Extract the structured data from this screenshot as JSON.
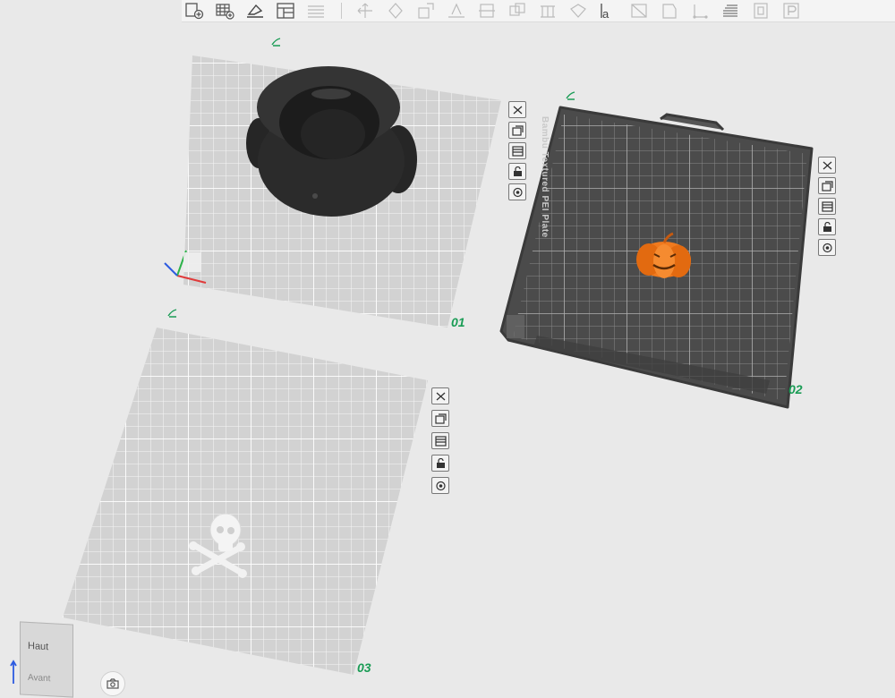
{
  "toolbar": {
    "items": [
      {
        "name": "add-plate-button",
        "icon": "add-plate-icon"
      },
      {
        "name": "auto-arrange-grid-button",
        "icon": "grid-plus-icon"
      },
      {
        "name": "orient-button",
        "icon": "orient-icon"
      },
      {
        "name": "arrange-button",
        "icon": "layout-icon"
      },
      {
        "name": "split-objects-button",
        "icon": "layers-icon"
      },
      {
        "name": "move-button",
        "icon": "move-icon"
      },
      {
        "name": "rotate-button",
        "icon": "rotate-icon"
      },
      {
        "name": "scale-button",
        "icon": "scale-icon"
      },
      {
        "name": "lay-on-face-button",
        "icon": "lay-face-icon"
      },
      {
        "name": "cut-button",
        "icon": "cut-icon"
      },
      {
        "name": "mesh-boolean-button",
        "icon": "boolean-icon"
      },
      {
        "name": "support-paint-button",
        "icon": "support-icon"
      },
      {
        "name": "seam-paint-button",
        "icon": "seam-icon"
      },
      {
        "name": "text-button",
        "icon": "text-icon",
        "label": "a"
      },
      {
        "name": "measure-button",
        "icon": "measure-icon"
      },
      {
        "name": "assembly-button",
        "icon": "assembly-icon"
      },
      {
        "name": "variable-layer-button",
        "icon": "variable-layer-icon"
      },
      {
        "name": "slice-preview-button",
        "icon": "slice-icon"
      },
      {
        "name": "object-list-button",
        "icon": "object-list-icon"
      },
      {
        "name": "plate-settings-button",
        "icon": "plate-settings-icon"
      }
    ]
  },
  "plates": [
    {
      "id": "plate-01",
      "number": "01",
      "bed_color": "#d2d2d2",
      "object": "cauldron",
      "object_color": "#2a2a2a"
    },
    {
      "id": "plate-02",
      "number": "02",
      "bed_color": "#4b4b4b",
      "bed_label": "Bambu Textured PEI Plate",
      "object": "pumpkin",
      "object_color": "#f07a1e"
    },
    {
      "id": "plate-03",
      "number": "03",
      "bed_color": "#d2d2d2",
      "object": "skull-and-crossbones",
      "object_color": "#f2f2f2"
    }
  ],
  "plate_side_icons": [
    {
      "name": "remove-plate-button",
      "icon": "close-icon"
    },
    {
      "name": "arrange-plate-button",
      "icon": "arrange-icon"
    },
    {
      "name": "orient-plate-button",
      "icon": "orient-plate-icon"
    },
    {
      "name": "lock-plate-button",
      "icon": "lock-icon"
    },
    {
      "name": "plate-settings-button",
      "icon": "settings-gear-icon"
    }
  ],
  "viewcube": {
    "top_label": "Haut",
    "front_label": "Avant"
  },
  "colors": {
    "accent": "#1a9c55",
    "axis_x": "#e03a3a",
    "axis_y": "#2db34a",
    "axis_z": "#2d5be0"
  }
}
